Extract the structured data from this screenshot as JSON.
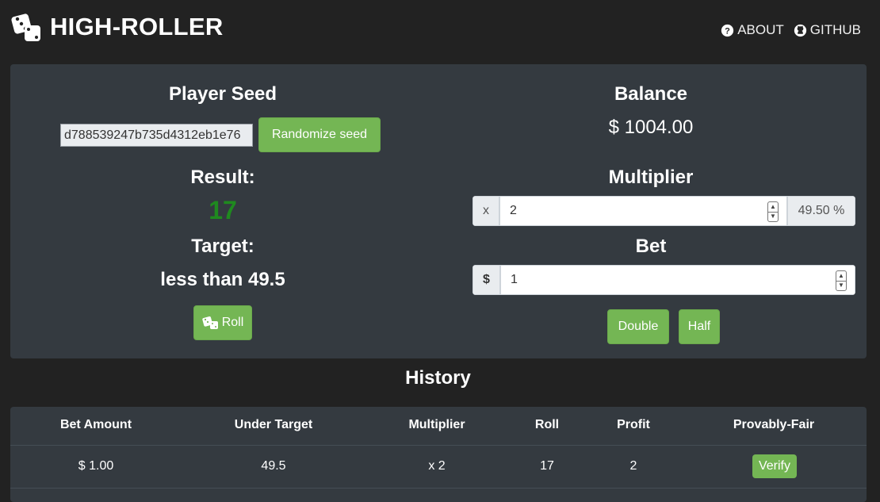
{
  "nav": {
    "brand": "HIGH-ROLLER",
    "about": "ABOUT",
    "github": "GITHUB"
  },
  "player_seed": {
    "heading": "Player Seed",
    "value": "d788539247b735d4312eb1e76",
    "randomize_label": "Randomize seed"
  },
  "result": {
    "heading": "Result:",
    "value": "17",
    "value_color": "#1f8a1f"
  },
  "target": {
    "heading": "Target:",
    "value": "less than 49.5"
  },
  "roll": {
    "label": "Roll"
  },
  "balance": {
    "heading": "Balance",
    "value": "$ 1004.00"
  },
  "multiplier": {
    "heading": "Multiplier",
    "prefix": "x",
    "value": "2",
    "chance": "49.50 %"
  },
  "bet": {
    "heading": "Bet",
    "prefix": "$",
    "value": "1",
    "double_label": "Double",
    "half_label": "Half"
  },
  "history": {
    "title": "History",
    "columns": [
      "Bet Amount",
      "Under Target",
      "Multiplier",
      "Roll",
      "Profit",
      "Provably-Fair"
    ],
    "rows": [
      {
        "bet_amount": "$ 1.00",
        "under_target": "49.5",
        "multiplier": "x 2",
        "roll": "17",
        "profit": "2",
        "verify_label": "Verify"
      }
    ]
  },
  "colors": {
    "background": "#222222",
    "card": "#343a40",
    "accent_green": "#74b654"
  },
  "icons": [
    "dice-icon",
    "question-circle-icon",
    "github-icon",
    "dice-small-icon"
  ]
}
